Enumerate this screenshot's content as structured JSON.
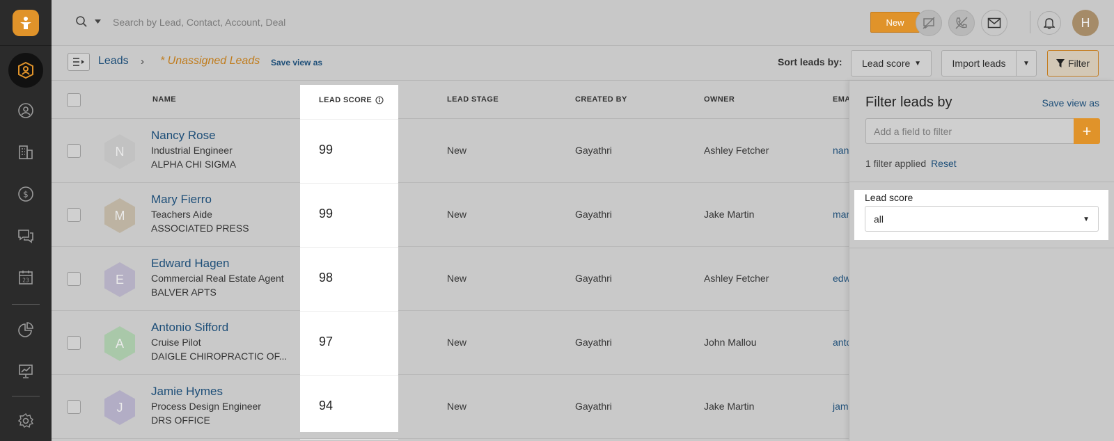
{
  "search": {
    "placeholder": "Search by Lead, Contact, Account, Deal"
  },
  "topbar": {
    "new_label": "New",
    "avatar_initial": "H"
  },
  "breadcrumb": {
    "root": "Leads",
    "separator": "›",
    "view": "* Unassigned Leads",
    "save_view": "Save view as"
  },
  "sort": {
    "label": "Sort leads by:",
    "value": "Lead score"
  },
  "import": {
    "label": "Import leads"
  },
  "filter_button": {
    "label": "Filter"
  },
  "columns": {
    "name": "NAME",
    "lead_score": "LEAD SCORE",
    "lead_stage": "LEAD STAGE",
    "created_by": "CREATED BY",
    "owner": "OWNER",
    "email": "EMA"
  },
  "rows": [
    {
      "initial": "N",
      "avatar_color": "#c2c2c2",
      "name": "Nancy Rose",
      "title": "Industrial Engineer",
      "company": "ALPHA CHI SIGMA",
      "score": "99",
      "stage": "New",
      "created_by": "Gayathri",
      "owner": "Ashley Fetcher",
      "email": "nan"
    },
    {
      "initial": "M",
      "avatar_color": "#bdb3a2",
      "name": "Mary Fierro",
      "title": "Teachers Aide",
      "company": "ASSOCIATED PRESS",
      "score": "99",
      "stage": "New",
      "created_by": "Gayathri",
      "owner": "Jake Martin",
      "email": "mar"
    },
    {
      "initial": "E",
      "avatar_color": "#b5b0c4",
      "name": "Edward Hagen",
      "title": "Commercial Real Estate Agent",
      "company": "BALVER APTS",
      "score": "98",
      "stage": "New",
      "created_by": "Gayathri",
      "owner": "Ashley Fetcher",
      "email": "edw"
    },
    {
      "initial": "A",
      "avatar_color": "#a9c8a9",
      "name": "Antonio Sifford",
      "title": "Cruise Pilot",
      "company": "DAIGLE CHIROPRACTIC OF...",
      "score": "97",
      "stage": "New",
      "created_by": "Gayathri",
      "owner": "John Mallou",
      "email": "anto"
    },
    {
      "initial": "J",
      "avatar_color": "#b2adc5",
      "name": "Jamie Hymes",
      "title": "Process Design Engineer",
      "company": "DRS OFFICE",
      "score": "94",
      "stage": "New",
      "created_by": "Gayathri",
      "owner": "Jake Martin",
      "email": "jam"
    }
  ],
  "filter_panel": {
    "title": "Filter leads by",
    "save_view": "Save view as",
    "add_placeholder": "Add a field to filter",
    "add_symbol": "+",
    "applied_text": "1 filter applied",
    "reset_label": "Reset",
    "lead_score_label": "Lead score",
    "lead_score_value": "all"
  },
  "colors": {
    "accent": "#e0932a",
    "link": "#1d4e78",
    "rail": "#2b2b2b"
  }
}
